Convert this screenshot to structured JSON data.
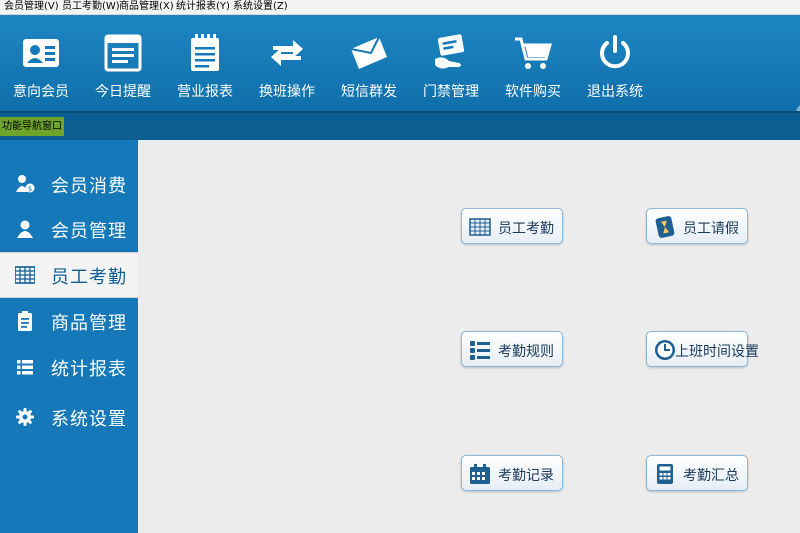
{
  "menubar": [
    "会员管理(V)",
    "员工考勤(W)",
    "商品管理(X)",
    "统计报表(Y)",
    "系统设置(Z)"
  ],
  "toolbar": [
    {
      "label": "意向会员",
      "icon": "member-card-icon"
    },
    {
      "label": "今日提醒",
      "icon": "reminder-browser-icon"
    },
    {
      "label": "营业报表",
      "icon": "clipboard-report-icon"
    },
    {
      "label": "换班操作",
      "icon": "swap-arrows-icon"
    },
    {
      "label": "短信群发",
      "icon": "envelope-icon"
    },
    {
      "label": "门禁管理",
      "icon": "access-card-icon"
    },
    {
      "label": "软件购买",
      "icon": "shopping-cart-icon"
    },
    {
      "label": "退出系统",
      "icon": "power-icon"
    }
  ],
  "nav_tab": "功能导航窗口",
  "sidebar": [
    {
      "label": "会员消费",
      "icon": "member-payment-icon",
      "active": false
    },
    {
      "label": "会员管理",
      "icon": "person-icon",
      "active": false
    },
    {
      "label": "员工考勤",
      "icon": "grid-table-icon",
      "active": true
    },
    {
      "label": "商品管理",
      "icon": "clipboard-icon",
      "active": false
    },
    {
      "label": "统计报表",
      "icon": "list-icon",
      "active": false
    },
    {
      "label": "系统设置",
      "icon": "gear-icon",
      "active": false
    }
  ],
  "functions": [
    {
      "label": "员工考勤",
      "icon": "attendance-grid-icon"
    },
    {
      "label": "员工请假",
      "icon": "hourglass-phone-icon"
    },
    {
      "label": "考勤规则",
      "icon": "rules-list-icon"
    },
    {
      "label": "上班时间设置",
      "icon": "clock-icon"
    },
    {
      "label": "考勤记录",
      "icon": "calendar-icon"
    },
    {
      "label": "考勤汇总",
      "icon": "calculator-icon"
    }
  ],
  "colors": {
    "toolbar": "#1578b8",
    "sidebar": "#1578b8",
    "nav_tab": "#6fa52b",
    "active_text": "#0f5e93"
  }
}
